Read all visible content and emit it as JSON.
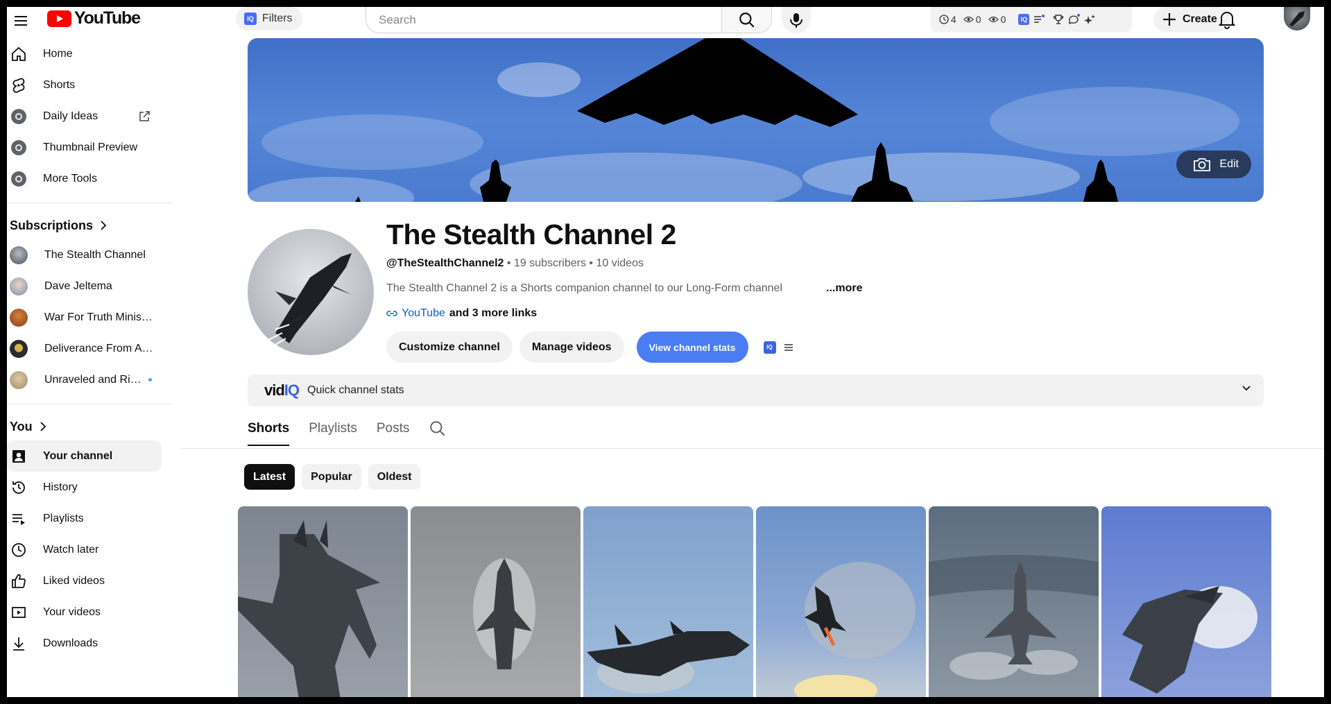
{
  "header": {
    "logo_text": "YouTube",
    "filters_label": "Filters",
    "search_placeholder": "Search",
    "vidiq_stats": [
      "4",
      "0",
      "0"
    ],
    "create_label": "Create",
    "iq_badge": "IQ"
  },
  "sidebar": {
    "main_items": [
      {
        "label": "Home",
        "icon": "home-icon"
      },
      {
        "label": "Shorts",
        "icon": "shorts-icon"
      },
      {
        "label": "Daily Ideas",
        "icon": "vidiq-icon"
      },
      {
        "label": "Thumbnail Preview",
        "icon": "vidiq-icon"
      },
      {
        "label": "More Tools",
        "icon": "vidiq-icon"
      }
    ],
    "subscriptions_heading": "Subscriptions",
    "subscriptions": [
      {
        "label": "The Stealth Channel",
        "color": "#4a4f57"
      },
      {
        "label": "Dave Jeltema",
        "color": "#7a8fb0"
      },
      {
        "label": "War For Truth Minis…",
        "color": "#8b3a1d"
      },
      {
        "label": "Deliverance From A…",
        "color": "#2b2b2b"
      },
      {
        "label": "Unraveled and Ri…",
        "color": "#a08c6a"
      }
    ],
    "you_heading": "You",
    "you_items": [
      {
        "label": "Your channel",
        "icon": "account-icon"
      },
      {
        "label": "History",
        "icon": "history-icon"
      },
      {
        "label": "Playlists",
        "icon": "playlists-icon"
      },
      {
        "label": "Watch later",
        "icon": "watch-later-icon"
      },
      {
        "label": "Liked videos",
        "icon": "like-icon"
      },
      {
        "label": "Your videos",
        "icon": "your-videos-icon"
      },
      {
        "label": "Downloads",
        "icon": "download-icon"
      }
    ]
  },
  "banner": {
    "edit_label": "Edit"
  },
  "channel": {
    "name": "The Stealth Channel 2",
    "handle": "@TheStealthChannel2",
    "subscribers": "19 subscribers",
    "videos": "10 videos",
    "separator": "•",
    "description": "The Stealth Channel 2 is a Shorts companion channel to our Long-Form channel",
    "more_label": "...more",
    "link_label": "YouTube",
    "more_links": "and 3 more links",
    "customize_label": "Customize channel",
    "manage_label": "Manage videos",
    "stats_label": "View channel stats"
  },
  "quick_stats": {
    "logo_vid": "vid",
    "logo_iq": "IQ",
    "label": "Quick channel stats"
  },
  "tabs": [
    "Shorts",
    "Playlists",
    "Posts"
  ],
  "chips": [
    "Latest",
    "Popular",
    "Oldest"
  ],
  "shorts": [
    {
      "bg_top": "#7d8590",
      "bg_bottom": "#9aa1aa"
    },
    {
      "bg_top": "#8a8d90",
      "bg_bottom": "#a9abad"
    },
    {
      "bg_top": "#7fa1cc",
      "bg_bottom": "#a4c0dc"
    },
    {
      "bg_top": "#6d92c9",
      "bg_bottom": "#c8cfd6"
    },
    {
      "bg_top": "#5c6d80",
      "bg_bottom": "#8e99a4"
    },
    {
      "bg_top": "#5d7bd0",
      "bg_bottom": "#8fa3dc"
    }
  ],
  "colors": {
    "accent_blue": "#4a7cf3",
    "youtube_red": "#ff0000",
    "vidiq_blue": "#3c63e0",
    "link_blue": "#065fd4"
  }
}
